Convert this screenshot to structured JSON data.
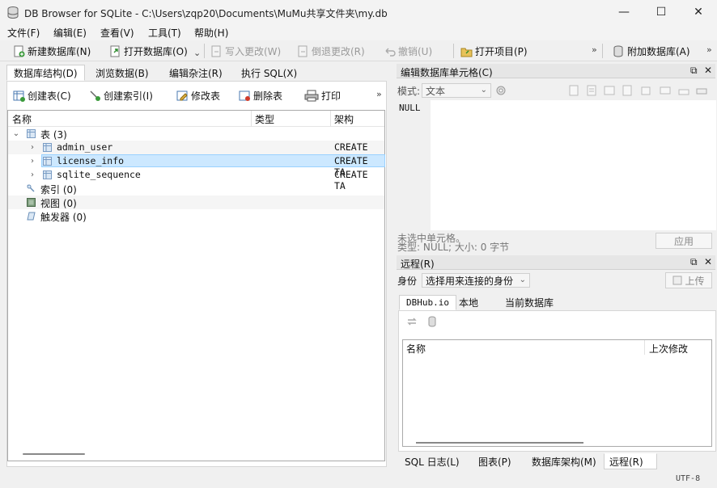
{
  "window": {
    "title": "DB Browser for SQLite - C:\\Users\\zqp20\\Documents\\MuMu共享文件夹\\my.db",
    "minimize": "—",
    "maximize": "☐",
    "close": "✕"
  },
  "menu": [
    "文件(F)",
    "编辑(E)",
    "查看(V)",
    "工具(T)",
    "帮助(H)"
  ],
  "toolbar": {
    "new_db": "新建数据库(N)",
    "open_db": "打开数据库(O)",
    "write_changes": "写入更改(W)",
    "revert_changes": "倒退更改(R)",
    "undo": "撤销(U)",
    "open_project": "打开项目(P)",
    "attach_db": "附加数据库(A)",
    "more": "»"
  },
  "left_tabs": [
    "数据库结构(D)",
    "浏览数据(B)",
    "编辑杂注(R)",
    "执行 SQL(X)"
  ],
  "structure_toolbar": {
    "create_table": "创建表(C)",
    "create_index": "创建索引(I)",
    "modify_table": "修改表",
    "delete_table": "删除表",
    "print": "打印",
    "more": "»"
  },
  "tree": {
    "headers": [
      "名称",
      "类型",
      "架构"
    ],
    "tables_label": "表 (3)",
    "tables": [
      {
        "name": "admin_user",
        "schema": "CREATE TA"
      },
      {
        "name": "license_info",
        "schema": "CREATE TA"
      },
      {
        "name": "sqlite_sequence",
        "schema": "CREATE TA"
      }
    ],
    "indices_label": "索引 (0)",
    "views_label": "视图 (0)",
    "triggers_label": "触发器 (0)"
  },
  "edit_cell": {
    "title": "编辑数据库单元格(C)",
    "mode_label": "模式:",
    "mode_value": "文本",
    "content": "NULL",
    "status_line1": "未选中单元格。",
    "status_line2": "类型: NULL; 大小: 0 字节",
    "apply": "应用"
  },
  "remote": {
    "title": "远程(R)",
    "identity_label": "身份",
    "identity_value": "选择用来连接的身份",
    "upload": "上传",
    "tabs": [
      "DBHub.io",
      "本地",
      "当前数据库"
    ],
    "columns": [
      "名称",
      "上次修改"
    ]
  },
  "bottom_tabs": [
    "SQL 日志(L)",
    "图表(P)",
    "数据库架构(M)",
    "远程(R)"
  ],
  "status": {
    "encoding": "UTF-8"
  },
  "colors": {
    "selection": "#cce8ff",
    "selection_border": "#99d1ff"
  }
}
